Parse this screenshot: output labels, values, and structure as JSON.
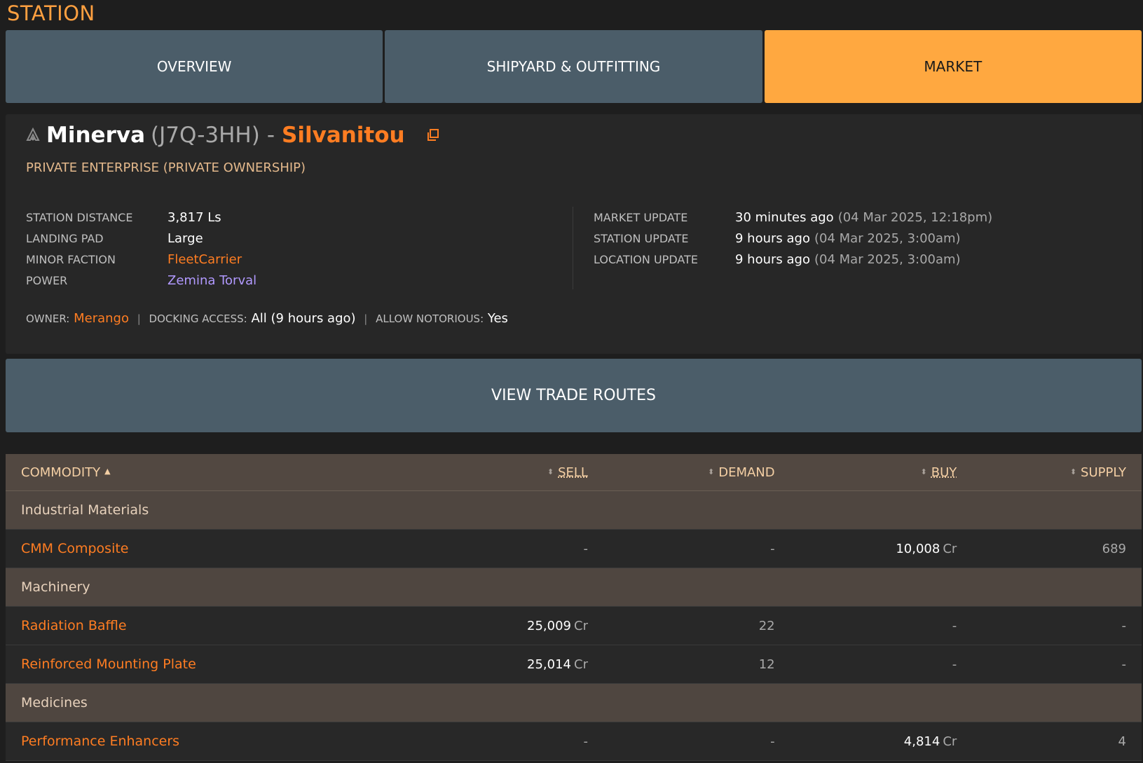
{
  "page_title": "STATION",
  "tabs": [
    {
      "label": "OVERVIEW",
      "active": false
    },
    {
      "label": "SHIPYARD & OUTFITTING",
      "active": false
    },
    {
      "label": "MARKET",
      "active": true
    }
  ],
  "station": {
    "name": "Minerva",
    "code": "(J7Q-3HH)",
    "separator": "-",
    "system": "Silvanitou",
    "type": "PRIVATE ENTERPRISE (PRIVATE OWNERSHIP)",
    "station_icon": "carrier-icon",
    "external_link_icon": "external-link-icon"
  },
  "details_left": [
    {
      "label": "STATION DISTANCE",
      "value": "3,817 Ls"
    },
    {
      "label": "LANDING PAD",
      "value": "Large"
    },
    {
      "label": "MINOR FACTION",
      "value": "FleetCarrier"
    },
    {
      "label": "POWER",
      "value": "Zemina Torval"
    }
  ],
  "details_right": [
    {
      "label": "MARKET UPDATE",
      "value": "30 minutes ago",
      "sub": "(04 Mar 2025, 12:18pm)"
    },
    {
      "label": "STATION UPDATE",
      "value": "9 hours ago",
      "sub": "(04 Mar 2025, 3:00am)"
    },
    {
      "label": "LOCATION UPDATE",
      "value": "9 hours ago",
      "sub": "(04 Mar 2025, 3:00am)"
    }
  ],
  "owner_line": {
    "owner_label": "OWNER:",
    "owner": "Merango",
    "separator": "|",
    "docking_label": "DOCKING ACCESS:",
    "docking": "All (9 hours ago)",
    "notorious_label": "ALLOW NOTORIOUS:",
    "notorious": "Yes"
  },
  "trade_routes_button": "VIEW TRADE ROUTES",
  "market": {
    "columns": {
      "commodity": "COMMODITY",
      "sell": "SELL",
      "demand": "DEMAND",
      "buy": "BUY",
      "supply": "SUPPLY"
    },
    "unit": "Cr",
    "categories": [
      {
        "name": "Industrial Materials",
        "items": [
          {
            "name": "CMM Composite",
            "sell": "-",
            "demand": "-",
            "buy": "10,008",
            "supply": "689"
          }
        ]
      },
      {
        "name": "Machinery",
        "items": [
          {
            "name": "Radiation Baffle",
            "sell": "25,009",
            "demand": "22",
            "buy": "-",
            "supply": "-"
          },
          {
            "name": "Reinforced Mounting Plate",
            "sell": "25,014",
            "demand": "12",
            "buy": "-",
            "supply": "-"
          }
        ]
      },
      {
        "name": "Medicines",
        "items": [
          {
            "name": "Performance Enhancers",
            "sell": "-",
            "demand": "-",
            "buy": "4,814",
            "supply": "4"
          }
        ]
      }
    ]
  },
  "colors": {
    "accent": "#ffa840",
    "link": "#ff7d22",
    "power": "#b199ff",
    "tab_bg": "#4b5d69"
  }
}
